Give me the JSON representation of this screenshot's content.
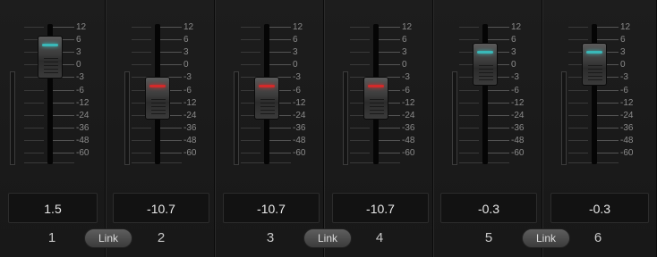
{
  "scale_labels": [
    "12",
    "6",
    "3",
    "0",
    "-3",
    "-6",
    "-12",
    "-24",
    "-36",
    "-48",
    "-60"
  ],
  "channels": [
    {
      "number": "1",
      "value": "1.5",
      "level_fraction": 0.81,
      "lamp": "#3ab8b8"
    },
    {
      "number": "2",
      "value": "-10.7",
      "level_fraction": 0.57,
      "lamp": "#d42a2a"
    },
    {
      "number": "3",
      "value": "-10.7",
      "level_fraction": 0.57,
      "lamp": "#d42a2a"
    },
    {
      "number": "4",
      "value": "-10.7",
      "level_fraction": 0.57,
      "lamp": "#d42a2a"
    },
    {
      "number": "5",
      "value": "-0.3",
      "level_fraction": 0.77,
      "lamp": "#3ab8b8"
    },
    {
      "number": "6",
      "value": "-0.3",
      "level_fraction": 0.77,
      "lamp": "#3ab8b8"
    }
  ],
  "link_label": "Link",
  "colors": {
    "background": "#0e0e0e",
    "strip": "#1b1b1b",
    "text": "#e8e8e8",
    "cyan_lamp": "#3ab8b8",
    "red_lamp": "#d42a2a"
  }
}
